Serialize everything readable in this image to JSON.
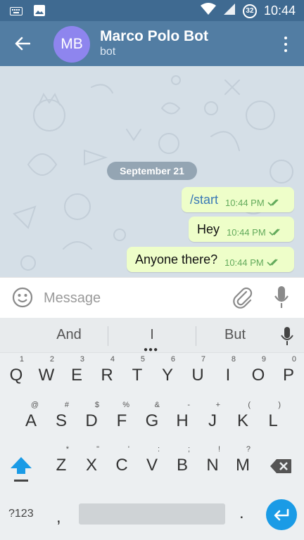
{
  "status_bar": {
    "time": "10:44",
    "battery_level": "32",
    "icons": [
      "keyboard-icon",
      "image-icon",
      "wifi-icon",
      "signal-icon",
      "battery-icon"
    ]
  },
  "header": {
    "avatar_initials": "MB",
    "title": "Marco Polo Bot",
    "subtitle": "bot",
    "avatar_color": "#8e85ee",
    "bar_color": "#527da3"
  },
  "chat": {
    "date_label": "September 21",
    "messages": [
      {
        "text": "/start",
        "time": "10:44 PM",
        "status": "read"
      },
      {
        "text": "Hey",
        "time": "10:44 PM",
        "status": "read"
      },
      {
        "text": "Anyone there?",
        "time": "10:44 PM",
        "status": "read"
      }
    ]
  },
  "composer": {
    "placeholder": "Message"
  },
  "keyboard": {
    "suggestions": [
      "And",
      "I",
      "But"
    ],
    "rows": [
      [
        {
          "k": "Q",
          "h": "1"
        },
        {
          "k": "W",
          "h": "2"
        },
        {
          "k": "E",
          "h": "3"
        },
        {
          "k": "R",
          "h": "4"
        },
        {
          "k": "T",
          "h": "5"
        },
        {
          "k": "Y",
          "h": "6"
        },
        {
          "k": "U",
          "h": "7"
        },
        {
          "k": "I",
          "h": "8"
        },
        {
          "k": "O",
          "h": "9"
        },
        {
          "k": "P",
          "h": "0"
        }
      ],
      [
        {
          "k": "A",
          "h": "@"
        },
        {
          "k": "S",
          "h": "#"
        },
        {
          "k": "D",
          "h": "$"
        },
        {
          "k": "F",
          "h": "%"
        },
        {
          "k": "G",
          "h": "&"
        },
        {
          "k": "H",
          "h": "-"
        },
        {
          "k": "J",
          "h": "+"
        },
        {
          "k": "K",
          "h": "("
        },
        {
          "k": "L",
          "h": ")"
        }
      ],
      [
        {
          "k": "Z",
          "h": "*"
        },
        {
          "k": "X",
          "h": "\""
        },
        {
          "k": "C",
          "h": "'"
        },
        {
          "k": "V",
          "h": ":"
        },
        {
          "k": "B",
          "h": ";"
        },
        {
          "k": "N",
          "h": "!"
        },
        {
          "k": "M",
          "h": "?"
        }
      ]
    ],
    "num_label": "?123",
    "comma": ",",
    "period": ".",
    "accent_color": "#1a9be6"
  }
}
